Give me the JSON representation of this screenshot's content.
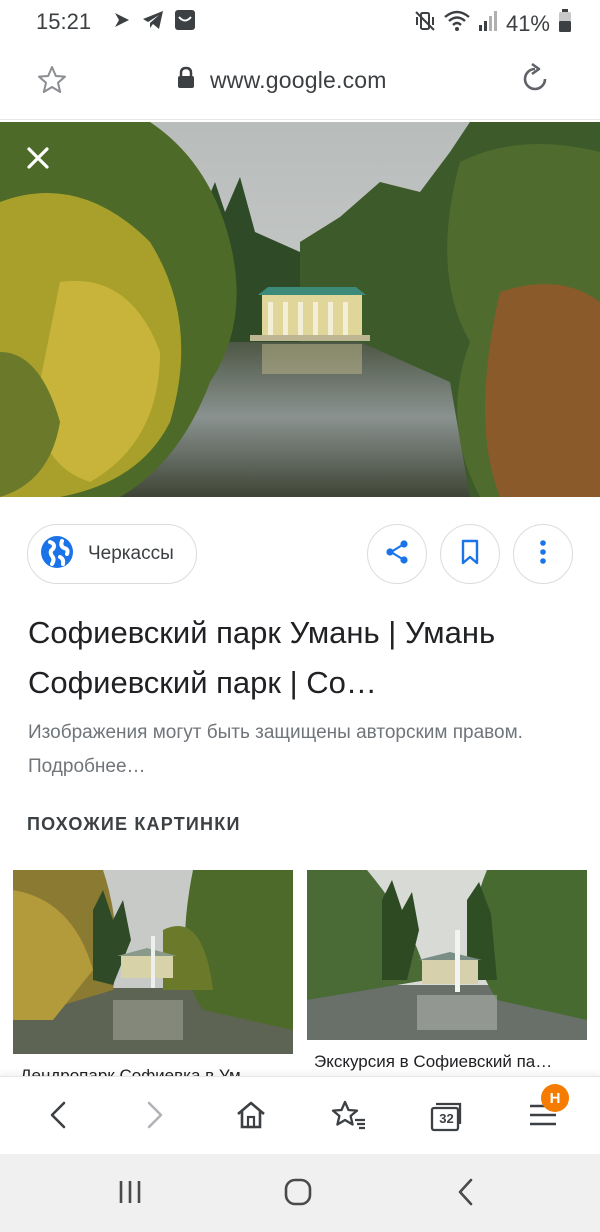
{
  "status_bar": {
    "time": "15:21",
    "battery_percent": "41%",
    "icons": [
      "notification-flag-icon",
      "telegram-icon",
      "mail-box-icon",
      "mute-vibrate-icon",
      "wifi-icon",
      "signal-icon",
      "battery-icon"
    ]
  },
  "address_bar": {
    "url": "www.google.com",
    "icons": [
      "star-icon",
      "lock-icon",
      "reload-icon"
    ]
  },
  "hero": {
    "close_icon": "close-icon"
  },
  "actions": {
    "source_label": "Черкассы",
    "buttons": [
      "share-icon",
      "bookmark-icon",
      "more-vert-icon"
    ],
    "accent_color": "#1a73e8"
  },
  "result": {
    "title": "Софиевский парк Умань | Умань Софиевский парк | Со…",
    "notice": "Изображения могут быть защищены авторским правом. Подробнее…"
  },
  "similar": {
    "heading": "ПОХОЖИЕ КАРТИНКИ",
    "items": [
      {
        "caption": "Дендропарк Софиевка в Ум…"
      },
      {
        "caption": "Экскурсия в Софиевский па…"
      }
    ]
  },
  "browser_toolbar": {
    "tab_count": "32",
    "badge": "Н",
    "badge_color": "#f57c00",
    "icons": [
      "back-icon",
      "forward-icon",
      "home-icon",
      "bookmarks-star-icon",
      "tabs-icon",
      "menu-icon"
    ]
  },
  "system_nav": {
    "icons": [
      "recent-apps-icon",
      "home-circle-icon",
      "system-back-icon"
    ]
  }
}
